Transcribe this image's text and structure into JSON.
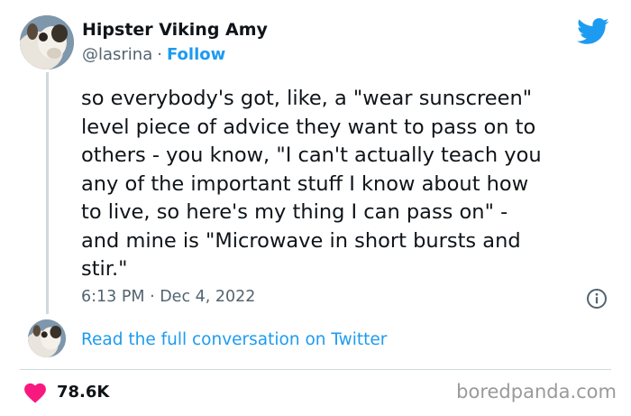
{
  "author": {
    "display_name": "Hipster Viking Amy",
    "handle": "@lasrina",
    "separator": "·",
    "follow_label": "Follow"
  },
  "tweet": {
    "text": "so everybody's got, like, a \"wear sunscreen\"\nlevel piece of advice they want to pass on to\nothers - you know, \"I can't actually teach you\nany of the important stuff I know about how\nto live, so here's my thing I can pass on\" -\nand mine is \"Microwave in short bursts and\nstir.\"",
    "timestamp": "6:13 PM · Dec 4, 2022"
  },
  "conversation_link": "Read the full conversation on Twitter",
  "likes": {
    "count": "78.6K"
  },
  "watermark": "boredpanda.com",
  "colors": {
    "accent": "#1d9bf0",
    "heart": "#f91880",
    "text": "#0f1419",
    "muted": "#536471",
    "divider": "#cfd9de"
  },
  "icons": {
    "brand": "twitter-bird-icon",
    "info": "info-icon",
    "like": "heart-icon"
  }
}
